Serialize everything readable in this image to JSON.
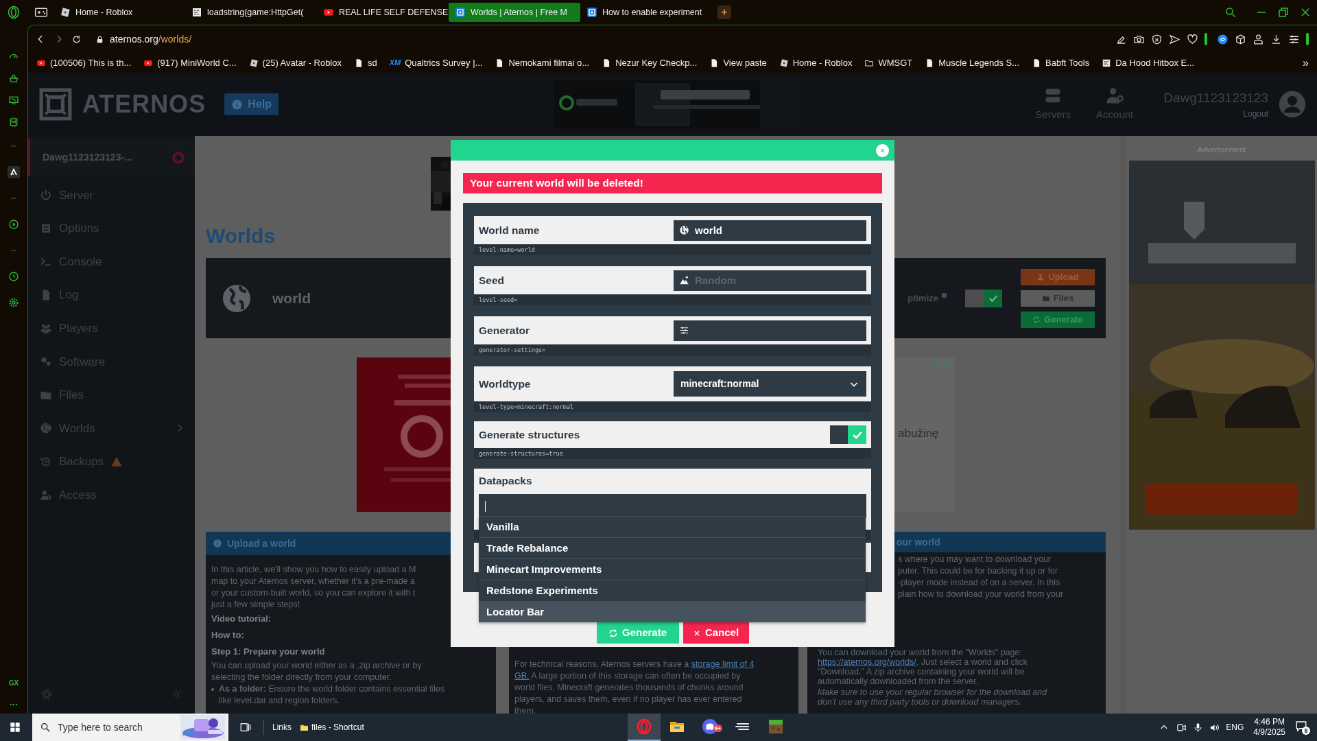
{
  "browser": {
    "tabs": [
      {
        "label": "Home - Roblox",
        "kind": "game",
        "selected": false
      },
      {
        "label": "loadstring(game:HttpGet(",
        "kind": "code",
        "selected": false
      },
      {
        "label": "REAL LIFE SELF DEFENSE",
        "kind": "video",
        "selected": false
      },
      {
        "label": "Worlds | Aternos | Free M",
        "kind": "site",
        "selected": true
      },
      {
        "label": "How to enable experiment",
        "kind": "site",
        "selected": false
      }
    ],
    "new_tab": "+",
    "address": {
      "domain": "aternos.org",
      "path": "/worlds/"
    },
    "bookmarks": [
      {
        "label": "(100506) This is th...",
        "kind": "video"
      },
      {
        "label": "(917) MiniWorld C...",
        "kind": "video"
      },
      {
        "label": "(25) Avatar - Roblox",
        "kind": "game"
      },
      {
        "label": "sd",
        "kind": "page"
      },
      {
        "label": "Qualtrics Survey |...",
        "kind": "survey",
        "mark": "XM"
      },
      {
        "label": "Nemokami filmai o...",
        "kind": "page"
      },
      {
        "label": "Nezur Key Checkp...",
        "kind": "page"
      },
      {
        "label": "View paste",
        "kind": "page"
      },
      {
        "label": "Home - Roblox",
        "kind": "game"
      },
      {
        "label": "WMSGT",
        "kind": "folder"
      },
      {
        "label": "Muscle Legends S...",
        "kind": "page"
      },
      {
        "label": "Babft Tools",
        "kind": "page"
      },
      {
        "label": "Da Hood Hitbox E...",
        "kind": "code"
      }
    ],
    "more": "»",
    "rail_badge": "GX"
  },
  "site": {
    "logo": "ATERNOS",
    "help": "Help",
    "nav": [
      "Servers",
      "Account"
    ],
    "user": {
      "name": "Dawg1123123123",
      "logout": "Logout"
    },
    "server": "Dawg1123123123-...",
    "menu": [
      {
        "label": "Server",
        "kind": "plain"
      },
      {
        "label": "Options",
        "kind": "plain"
      },
      {
        "label": "Console",
        "kind": "plain"
      },
      {
        "label": "Log",
        "kind": "plain"
      },
      {
        "label": "Players",
        "kind": "plain"
      },
      {
        "label": "Software",
        "kind": "plain"
      },
      {
        "label": "Files",
        "kind": "plain"
      },
      {
        "label": "Worlds",
        "kind": "submenu"
      },
      {
        "label": "Backups",
        "kind": "warning"
      },
      {
        "label": "Access",
        "kind": "plain"
      }
    ],
    "title": "Worlds",
    "world": {
      "name": "world",
      "optimize": "ptimize",
      "optimize_on": true,
      "actions": [
        "Upload",
        "Files",
        "Generate"
      ]
    },
    "ad_label": "Advertisement",
    "ad_snippet": "abužinę",
    "articles": [
      {
        "title": "Upload a world",
        "lines": [
          {
            "kind": "body",
            "text": "In this article, we'll show you how to easily upload a M"
          },
          {
            "kind": "body",
            "text": "map to your Aternos server, whether it's a pre-made a"
          },
          {
            "kind": "body",
            "text": "or your custom-built world, so you can explore it with t"
          },
          {
            "kind": "body",
            "text": "just a few simple steps!"
          },
          {
            "kind": "heading",
            "text": "Video tutorial:"
          },
          {
            "kind": "heading",
            "text": "How to:"
          },
          {
            "kind": "heading",
            "text": "Step 1: Prepare your world"
          },
          {
            "kind": "body",
            "text": "You can upload your world either as a .zip archive or by"
          },
          {
            "kind": "body",
            "text": "selecting the folder directly from your computer."
          },
          {
            "kind": "bullet",
            "text": "**As a folder:** Ensure the world folder contains essential files"
          },
          {
            "kind": "indent",
            "text": "like level.dat and region folders."
          }
        ]
      },
      {
        "lines": [
          {
            "kind": "body",
            "segments": [
              {
                "text": "For technical reasons, Aternos servers have a "
              },
              {
                "text": "storage limit of 4",
                "link": true
              }
            ]
          },
          {
            "kind": "body",
            "segments": [
              {
                "text": "GB.",
                "link": true
              },
              {
                "text": " A large portion of this storage can often be occupied by"
              }
            ]
          },
          {
            "kind": "body",
            "text": "world files. Minecraft generates thousands of chunks around"
          },
          {
            "kind": "body",
            "text": "players, and saves them, even if no player has ever entered"
          },
          {
            "kind": "body",
            "text": "them."
          }
        ]
      },
      {
        "title": "our world",
        "head_lines": [
          "s where you may want to download your",
          "puter. This could be for backing it up or for",
          "-player mode instead of on a server. In this",
          "plain how to download your world from your"
        ],
        "lines": [
          {
            "kind": "body",
            "text": "You can download your world from the \"Worlds\" page:"
          },
          {
            "kind": "body",
            "segments": [
              {
                "text": "https://aternos.org/worlds/",
                "link": true
              },
              {
                "text": ". Just select a world and click"
              }
            ]
          },
          {
            "kind": "body",
            "text": "\"Download.\" A zip archive containing your world will be"
          },
          {
            "kind": "body",
            "text": "automatically downloaded from the server."
          },
          {
            "kind": "note",
            "text": "Make sure to use your regular browser for the download and"
          },
          {
            "kind": "note",
            "text": "don't use any third party tools or download managers."
          }
        ]
      }
    ]
  },
  "modal": {
    "warning": "Your current world will be deleted!",
    "fields": [
      {
        "kind": "text",
        "label": "World name",
        "value": "world",
        "hint": "level-name=world"
      },
      {
        "kind": "text",
        "label": "Seed",
        "placeholder": "Random",
        "hint": "level-seed="
      },
      {
        "kind": "text",
        "label": "Generator",
        "hint": "generator-settings="
      },
      {
        "kind": "select",
        "label": "Worldtype",
        "value": "minecraft:normal",
        "hint": "level-type=minecraft:normal"
      },
      {
        "kind": "toggle",
        "label": "Generate structures",
        "on": true,
        "hint": "generate-structures=true"
      }
    ],
    "datapacks": {
      "label": "Datapacks",
      "options": [
        {
          "label": "Vanilla",
          "selected": false
        },
        {
          "label": "Trade Rebalance",
          "selected": false
        },
        {
          "label": "Minecart Improvements",
          "selected": false
        },
        {
          "label": "Redstone Experiments",
          "selected": false
        },
        {
          "label": "Locator Bar",
          "selected": true
        }
      ]
    },
    "generate": "Generate",
    "cancel": "Cancel"
  },
  "taskbar": {
    "search_placeholder": "Type here to search",
    "links": "Links",
    "shortcut": "files - Shortcut",
    "apps": [
      {
        "kind": "browser",
        "active": true
      },
      {
        "kind": "explorer",
        "active": false
      },
      {
        "kind": "chat",
        "active": false,
        "badge": "9+"
      },
      {
        "kind": "editor",
        "active": false
      },
      {
        "kind": "game",
        "active": false
      }
    ],
    "language": "ENG",
    "time": "4:46 PM",
    "date": "4/9/2025",
    "notifications": "8"
  }
}
